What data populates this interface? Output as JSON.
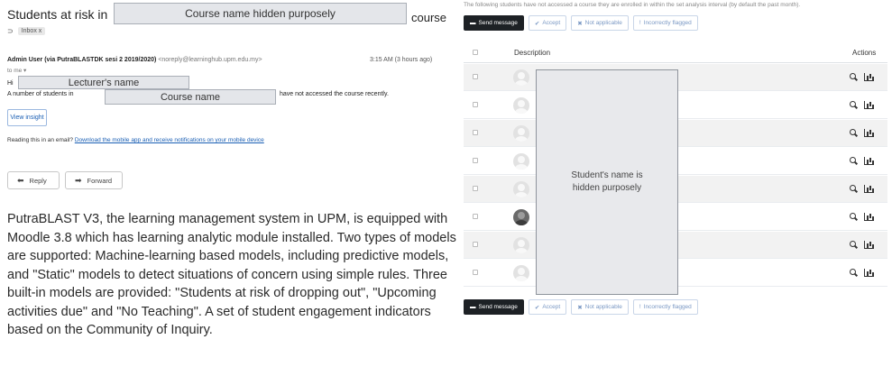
{
  "email": {
    "subject_prefix": "Students at risk in",
    "subject_hidden_note": "Course name hidden purposely",
    "subject_suffix": "course",
    "label_badge": "Inbox x",
    "sender_name": "Admin User (via PutraBLASTDK sesi 2 2019/2020)",
    "sender_address": "<noreply@learninghub.upm.edu.my>",
    "timestamp": "3:15 AM (3 hours ago)",
    "to_me": "to me ▾",
    "greeting": "Hi",
    "lecturer_hidden_note": "Lecturer's name",
    "body_prefix": "A number of students in",
    "course_hidden_note": "Course name",
    "body_suffix": "have not accessed the course recently.",
    "view_insight_label": "View insight",
    "reading_prefix": "Reading this in an email?",
    "reading_link": "Download the mobile app and receive notifications on your mobile device",
    "reply_label": "Reply",
    "forward_label": "Forward"
  },
  "paragraph": "PutraBLAST V3, the learning management system in UPM, is equipped with Moodle 3.8 which has learning analytic module installed. Two types of models are supported: Machine-learning based models, including predictive models, and \"Static\" models to detect situations of concern using simple rules. Three built-in models are provided: \"Students at risk of dropping out\", \"Upcoming activities due\" and \"No Teaching\". A set of student engagement indicators based on the Community of Inquiry.",
  "insights": {
    "intro": "The following students have not accessed a course they are enrolled in within the set analysis interval (by default the past month).",
    "toolbar": {
      "send_message": "Send message",
      "accept": "Accept",
      "not_applicable": "Not applicable",
      "incorrectly_flagged": "Incorrectly flagged"
    },
    "headers": {
      "description": "Description",
      "actions": "Actions"
    },
    "student_hidden_note": "Student's name is hidden purposely",
    "rows": [
      {
        "avatar": "default"
      },
      {
        "avatar": "default"
      },
      {
        "avatar": "default"
      },
      {
        "avatar": "default"
      },
      {
        "avatar": "default"
      },
      {
        "avatar": "photo"
      },
      {
        "avatar": "default"
      },
      {
        "avatar": "default"
      }
    ]
  },
  "icons": {
    "reply": "reply-arrow-icon",
    "forward": "forward-arrow-icon",
    "send": "speech-bubble-icon",
    "accept": "check-icon",
    "not_applicable": "x-icon",
    "incorrectly_flagged": "exclamation-icon",
    "view": "zoom-icon",
    "chart": "chart-icon"
  }
}
